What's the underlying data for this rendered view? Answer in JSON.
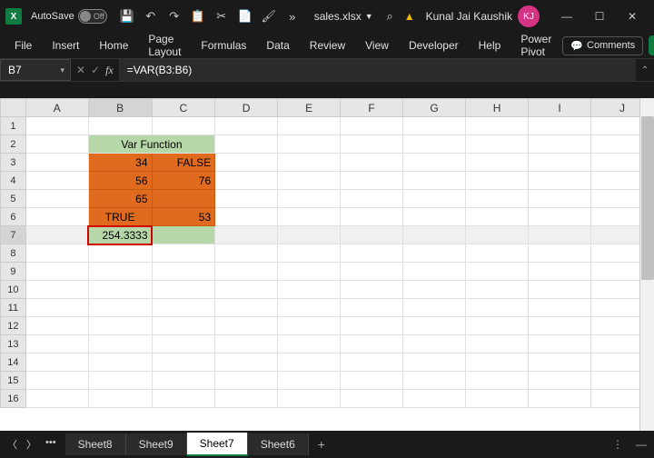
{
  "titlebar": {
    "autosave_label": "AutoSave",
    "autosave_state": "Off",
    "filename": "sales.xlsx",
    "user_name": "Kunal Jai Kaushik",
    "user_initials": "KJ"
  },
  "ribbon": {
    "tabs": [
      "File",
      "Insert",
      "Home",
      "Page Layout",
      "Formulas",
      "Data",
      "Review",
      "View",
      "Developer",
      "Help",
      "Power Pivot"
    ],
    "comments_label": "Comments"
  },
  "formula_bar": {
    "cell_ref": "B7",
    "formula": "=VAR(B3:B6)"
  },
  "columns": [
    "A",
    "B",
    "C",
    "D",
    "E",
    "F",
    "G",
    "H",
    "I",
    "J"
  ],
  "rows": [
    "1",
    "2",
    "3",
    "4",
    "5",
    "6",
    "7",
    "8",
    "9",
    "10",
    "11",
    "12",
    "13",
    "14",
    "15",
    "16"
  ],
  "table": {
    "title": "Var Function",
    "b3": "34",
    "c3": "FALSE",
    "b4": "56",
    "c4": "76",
    "b5": "65",
    "b6": "TRUE",
    "c6": "53",
    "b7": "254.3333"
  },
  "sheet_tabs": [
    "Sheet8",
    "Sheet9",
    "Sheet7",
    "Sheet6"
  ],
  "active_sheet": "Sheet7",
  "chart_data": {
    "type": "table",
    "title": "Var Function",
    "columns": [
      "B",
      "C"
    ],
    "rows": [
      [
        34,
        "FALSE"
      ],
      [
        56,
        76
      ],
      [
        65,
        null
      ],
      [
        "TRUE",
        53
      ]
    ],
    "result_cell": "B7",
    "result_formula": "=VAR(B3:B6)",
    "result_value": 254.3333
  }
}
